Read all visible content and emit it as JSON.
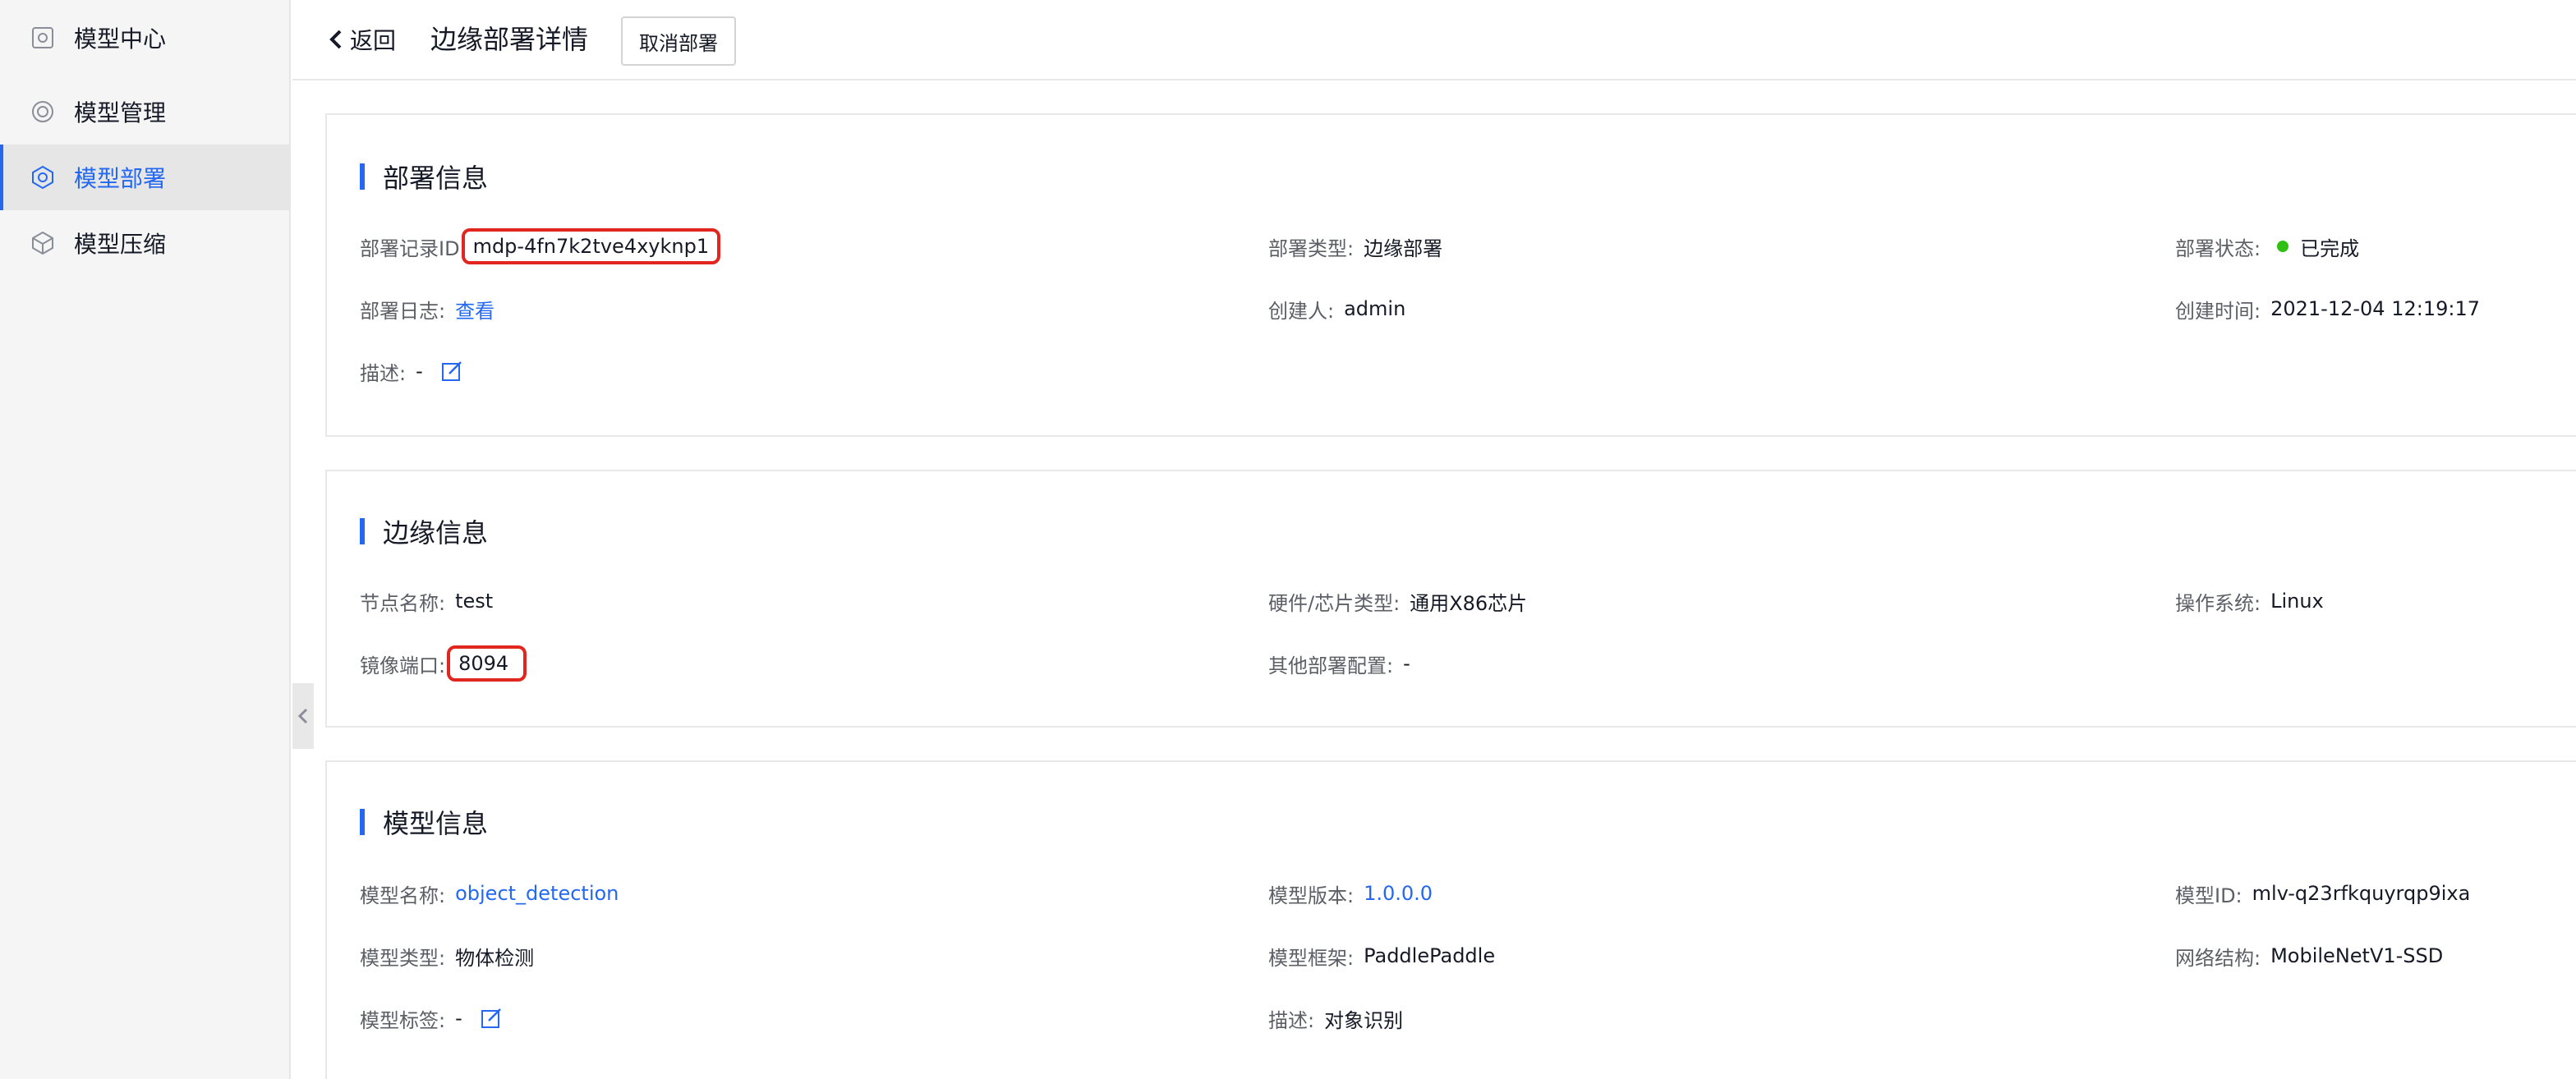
{
  "sidebar": {
    "items": [
      {
        "label": "模型中心",
        "icon": "model-center-icon"
      },
      {
        "label": "模型管理",
        "icon": "model-manage-icon"
      },
      {
        "label": "模型部署",
        "icon": "model-deploy-icon",
        "active": true
      },
      {
        "label": "模型压缩",
        "icon": "model-compress-icon"
      }
    ]
  },
  "header": {
    "back_label": "返回",
    "title": "边缘部署详情",
    "cancel_label": "取消部署"
  },
  "deploy_info": {
    "title": "部署信息",
    "record_id_label": "部署记录ID",
    "record_id": "mdp-4fn7k2tve4xyknp1",
    "type_label": "部署类型:",
    "type": "边缘部署",
    "status_label": "部署状态:",
    "status": "已完成",
    "status_color": "#30bf13",
    "log_label": "部署日志:",
    "log_link": "查看",
    "creator_label": "创建人:",
    "creator": "admin",
    "created_label": "创建时间:",
    "created": "2021-12-04 12:19:17",
    "desc_label": "描述:",
    "desc": "-"
  },
  "edge_info": {
    "title": "边缘信息",
    "node_label": "节点名称:",
    "node": "test",
    "hardware_label": "硬件/芯片类型:",
    "hardware": "通用X86芯片",
    "os_label": "操作系统:",
    "os": "Linux",
    "port_label": "镜像端口:",
    "port": "8094",
    "other_label": "其他部署配置:",
    "other": "-"
  },
  "model_info": {
    "title": "模型信息",
    "name_label": "模型名称:",
    "name": "object_detection",
    "version_label": "模型版本:",
    "version": "1.0.0.0",
    "id_label": "模型ID:",
    "id": "mlv-q23rfkquyrqp9ixa",
    "type_label": "模型类型:",
    "type": "物体检测",
    "framework_label": "模型框架:",
    "framework": "PaddlePaddle",
    "network_label": "网络结构:",
    "network": "MobileNetV1-SSD",
    "tag_label": "模型标签:",
    "tag": "-",
    "desc_label": "描述:",
    "desc": "对象识别"
  },
  "colors": {
    "accent": "#2468f2",
    "highlight_box": "#e0261f",
    "success": "#30bf13"
  }
}
